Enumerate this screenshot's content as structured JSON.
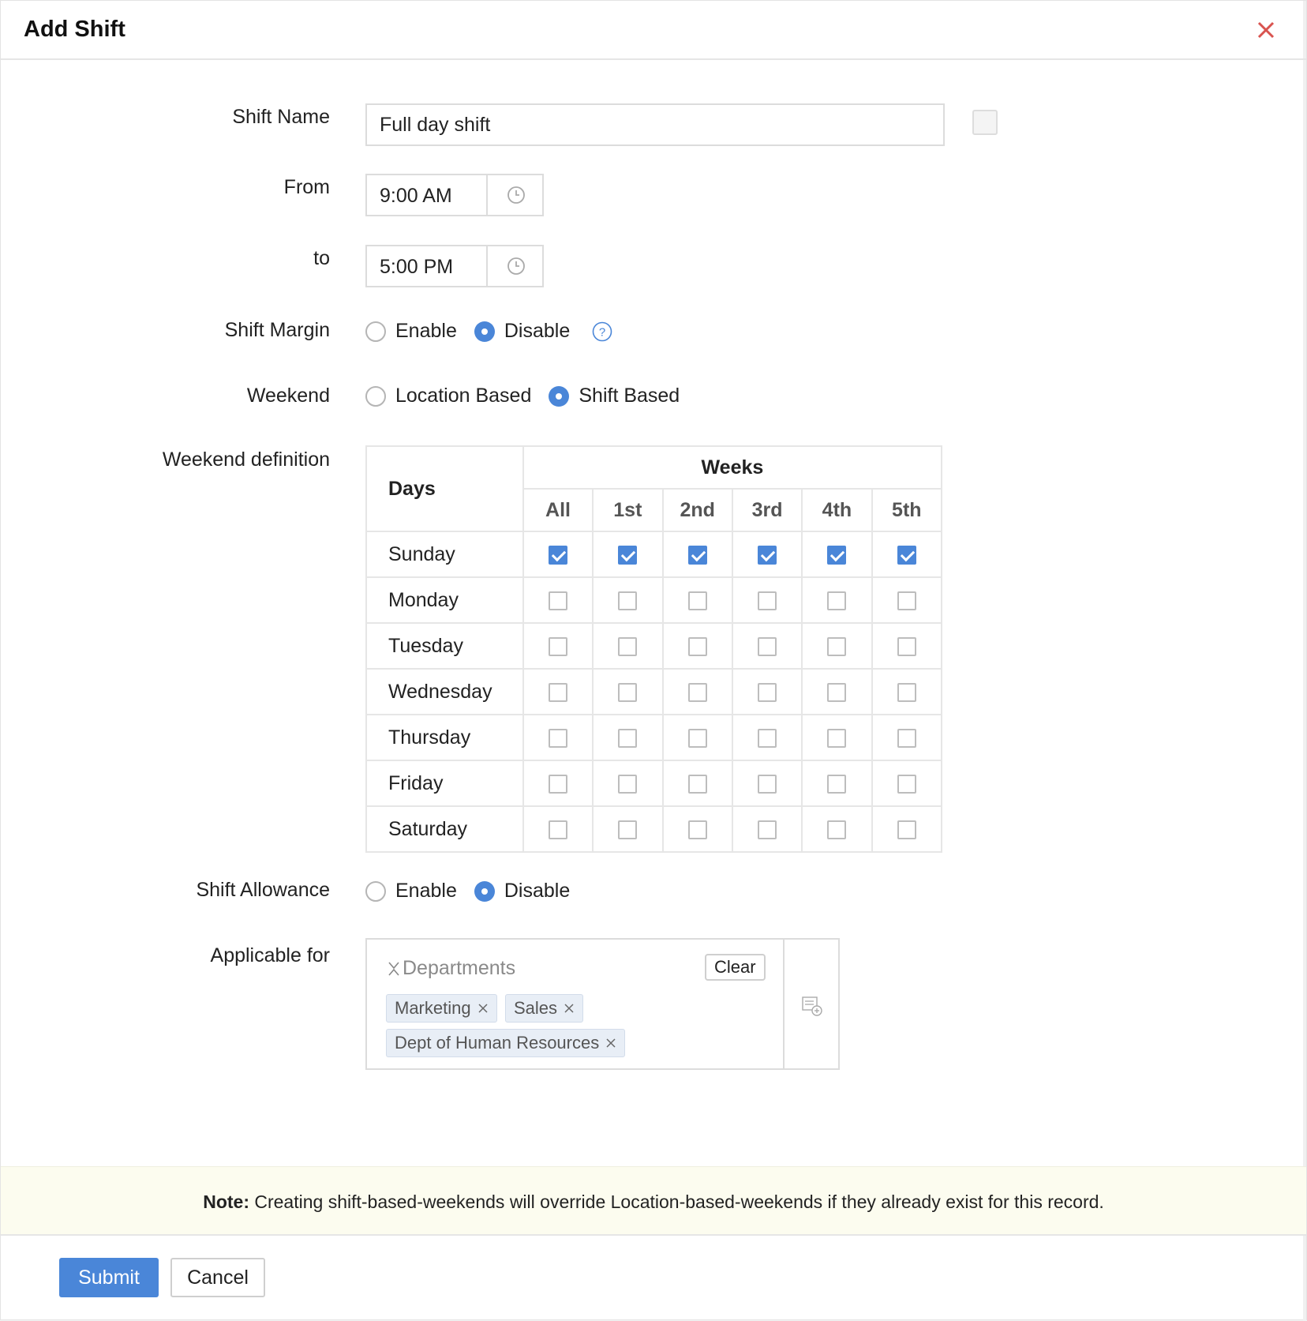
{
  "dialog": {
    "title": "Add Shift"
  },
  "form": {
    "shift_name": {
      "label": "Shift Name",
      "value": "Full day shift"
    },
    "from": {
      "label": "From",
      "value": "9:00 AM"
    },
    "to": {
      "label": "to",
      "value": "5:00 PM"
    },
    "shift_margin": {
      "label": "Shift Margin",
      "options": [
        "Enable",
        "Disable"
      ],
      "selected": "Disable"
    },
    "weekend": {
      "label": "Weekend",
      "options": [
        "Location Based",
        "Shift Based"
      ],
      "selected": "Shift Based"
    },
    "weekend_definition": {
      "label": "Weekend definition",
      "days_header": "Days",
      "weeks_header": "Weeks",
      "week_columns": [
        "All",
        "1st",
        "2nd",
        "3rd",
        "4th",
        "5th"
      ],
      "rows": [
        {
          "day": "Sunday",
          "checked": [
            true,
            true,
            true,
            true,
            true,
            true
          ]
        },
        {
          "day": "Monday",
          "checked": [
            false,
            false,
            false,
            false,
            false,
            false
          ]
        },
        {
          "day": "Tuesday",
          "checked": [
            false,
            false,
            false,
            false,
            false,
            false
          ]
        },
        {
          "day": "Wednesday",
          "checked": [
            false,
            false,
            false,
            false,
            false,
            false
          ]
        },
        {
          "day": "Thursday",
          "checked": [
            false,
            false,
            false,
            false,
            false,
            false
          ]
        },
        {
          "day": "Friday",
          "checked": [
            false,
            false,
            false,
            false,
            false,
            false
          ]
        },
        {
          "day": "Saturday",
          "checked": [
            false,
            false,
            false,
            false,
            false,
            false
          ]
        }
      ]
    },
    "shift_allowance": {
      "label": "Shift Allowance",
      "options": [
        "Enable",
        "Disable"
      ],
      "selected": "Disable"
    },
    "applicable_for": {
      "label": "Applicable for",
      "group": "Departments",
      "clear_label": "Clear",
      "tags": [
        "Marketing",
        "Sales",
        "Dept of Human Resources"
      ]
    }
  },
  "note": {
    "prefix": "Note:",
    "text": " Creating shift-based-weekends will override Location-based-weekends if they already exist for this record."
  },
  "footer": {
    "submit_label": "Submit",
    "cancel_label": "Cancel"
  },
  "colors": {
    "accent": "#4a86d8",
    "close": "#d9534f",
    "note_bg": "#fcfcef"
  }
}
